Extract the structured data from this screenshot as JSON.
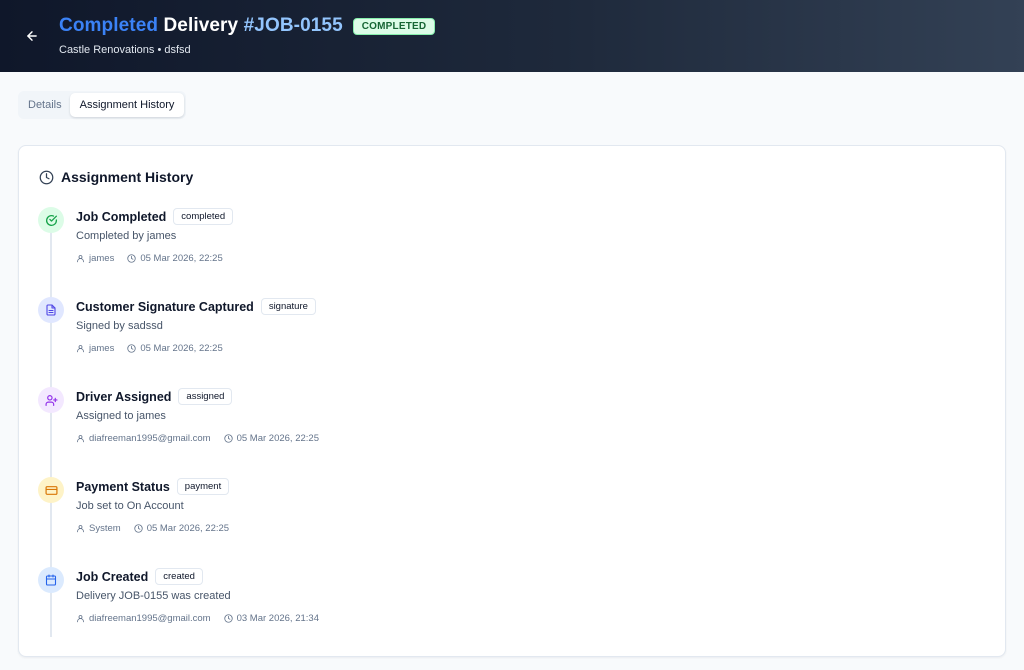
{
  "header": {
    "title_part1": "Completed",
    "title_part2": "Delivery",
    "title_part3": "#JOB-0155",
    "status": "COMPLETED",
    "subtitle": "Castle Renovations • dsfsd",
    "back_icon": "arrow-left-icon"
  },
  "tabs": [
    {
      "label": "Details",
      "active": false
    },
    {
      "label": "Assignment History",
      "active": true
    }
  ],
  "history": {
    "title": "Assignment History",
    "title_icon": "clock-icon",
    "events": [
      {
        "title": "Job Completed",
        "badge": "completed",
        "description": "Completed by james",
        "user": "james",
        "time": "05 Mar 2026, 22:25",
        "icon": "check-circle-icon",
        "color": "#16a34a",
        "bg": "#dcfce7"
      },
      {
        "title": "Customer Signature Captured",
        "badge": "signature",
        "description": "Signed by sadssd",
        "user": "james",
        "time": "05 Mar 2026, 22:25",
        "icon": "document-icon",
        "color": "#4f46e5",
        "bg": "#e0e7ff"
      },
      {
        "title": "Driver Assigned",
        "badge": "assigned",
        "description": "Assigned to james",
        "user": "diafreeman1995@gmail.com",
        "time": "05 Mar 2026, 22:25",
        "icon": "user-plus-icon",
        "color": "#9333ea",
        "bg": "#f3e8ff"
      },
      {
        "title": "Payment Status",
        "badge": "payment",
        "description": "Job set to On Account",
        "user": "System",
        "time": "05 Mar 2026, 22:25",
        "icon": "credit-card-icon",
        "color": "#d97706",
        "bg": "#fef3c7"
      },
      {
        "title": "Job Created",
        "badge": "created",
        "description": "Delivery JOB-0155 was created",
        "user": "diafreeman1995@gmail.com",
        "time": "03 Mar 2026, 21:34",
        "icon": "calendar-icon",
        "color": "#2563eb",
        "bg": "#dbeafe"
      }
    ]
  }
}
